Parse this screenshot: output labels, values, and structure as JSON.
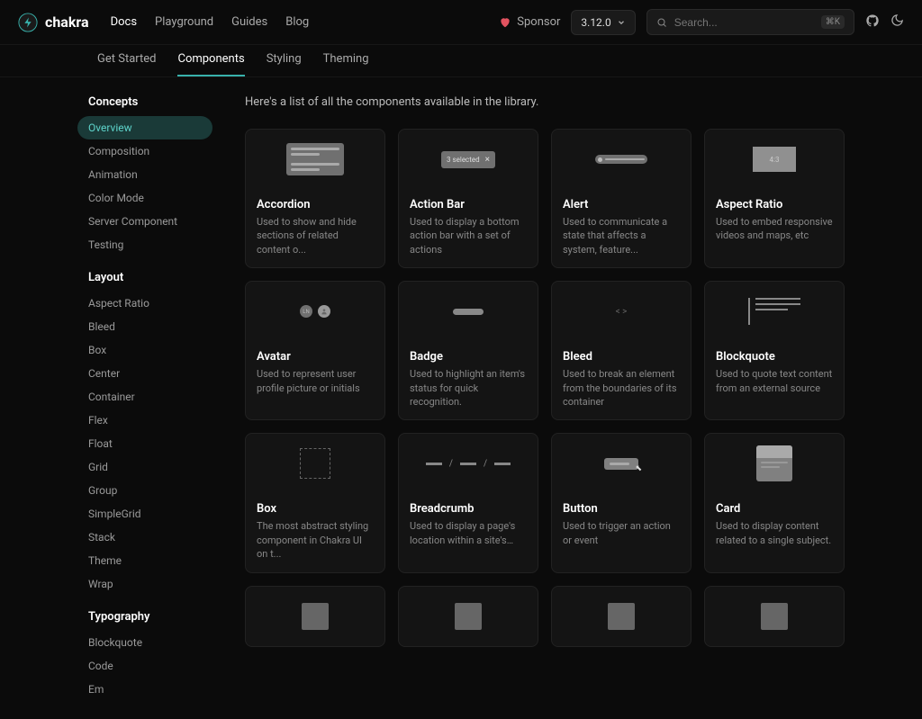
{
  "brand": "chakra",
  "topnav": [
    "Docs",
    "Playground",
    "Guides",
    "Blog"
  ],
  "topnav_active": 0,
  "sponsor": "Sponsor",
  "version": "3.12.0",
  "search_placeholder": "Search...",
  "search_kbd": "⌘K",
  "subnav": [
    "Get Started",
    "Components",
    "Styling",
    "Theming"
  ],
  "subnav_active": 1,
  "sidebar": {
    "sections": [
      {
        "title": "Concepts",
        "items": [
          "Overview",
          "Composition",
          "Animation",
          "Color Mode",
          "Server Component",
          "Testing"
        ],
        "active": 0
      },
      {
        "title": "Layout",
        "items": [
          "Aspect Ratio",
          "Bleed",
          "Box",
          "Center",
          "Container",
          "Flex",
          "Float",
          "Grid",
          "Group",
          "SimpleGrid",
          "Stack",
          "Theme",
          "Wrap"
        ],
        "active": -1
      },
      {
        "title": "Typography",
        "items": [
          "Blockquote",
          "Code",
          "Em"
        ],
        "active": -1
      }
    ]
  },
  "intro": "Here's a list of all the components available in the library.",
  "components": [
    {
      "title": "Accordion",
      "desc": "Used to show and hide sections of related content o...",
      "preview": "accordion"
    },
    {
      "title": "Action Bar",
      "desc": "Used to display a bottom action bar with a set of actions",
      "preview": "actionbar",
      "actionbar_text": "3 selected"
    },
    {
      "title": "Alert",
      "desc": "Used to communicate a state that affects a system, feature...",
      "preview": "alert"
    },
    {
      "title": "Aspect Ratio",
      "desc": "Used to embed responsive videos and maps, etc",
      "preview": "aspect",
      "aspect_text": "4:3"
    },
    {
      "title": "Avatar",
      "desc": "Used to represent user profile picture or initials",
      "preview": "avatar",
      "avatar_text": "LN"
    },
    {
      "title": "Badge",
      "desc": "Used to highlight an item's status for quick recognition.",
      "preview": "badge"
    },
    {
      "title": "Bleed",
      "desc": "Used to break an element from the boundaries of its container",
      "preview": "bleed"
    },
    {
      "title": "Blockquote",
      "desc": "Used to quote text content from an external source",
      "preview": "blockquote"
    },
    {
      "title": "Box",
      "desc": "The most abstract styling component in Chakra UI on t...",
      "preview": "box"
    },
    {
      "title": "Breadcrumb",
      "desc": "Used to display a page's location within a site's…",
      "preview": "breadcrumb"
    },
    {
      "title": "Button",
      "desc": "Used to trigger an action or event",
      "preview": "button"
    },
    {
      "title": "Card",
      "desc": "Used to display content related to a single subject.",
      "preview": "card"
    },
    {
      "title": "",
      "desc": "",
      "preview": "stub"
    },
    {
      "title": "",
      "desc": "",
      "preview": "stub"
    },
    {
      "title": "",
      "desc": "",
      "preview": "stub"
    },
    {
      "title": "",
      "desc": "",
      "preview": "stub"
    }
  ]
}
